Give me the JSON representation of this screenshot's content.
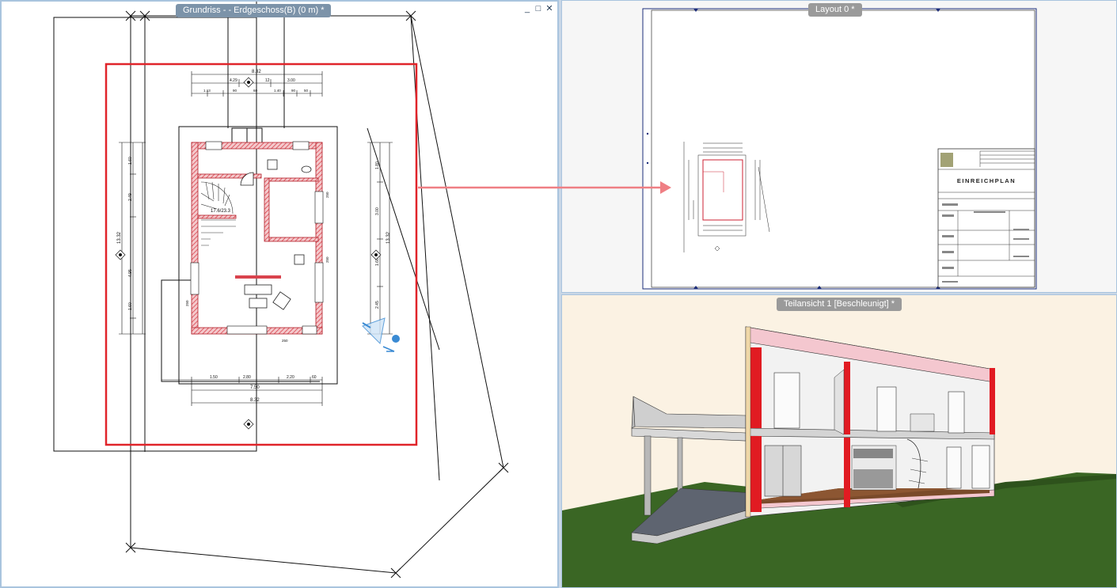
{
  "panes": {
    "plan": {
      "tab_label": "Grundriss -  - Erdgeschoss(B) (0 m) *",
      "controls": {
        "minimize": "_",
        "maximize": "□",
        "close": "✕"
      },
      "room_label": "17.6/23.3",
      "dimensions": {
        "top_total": "8.32",
        "top_row1": [
          "4.29",
          "12",
          "3.00"
        ],
        "top_row2": [
          "1.13",
          "90",
          "60",
          "1.40",
          "90",
          "50"
        ],
        "bottom_row1": [
          "1.50",
          "2.80",
          "2.20",
          "60"
        ],
        "bottom_total": "7.50",
        "bottom_overall": "8.32",
        "left_total": "13.32",
        "right_total": "13.32",
        "left_segments": [
          "1.60",
          "2.49",
          "4.95",
          "1.60"
        ],
        "right_segments": [
          "1.80",
          "3.00",
          "1.60",
          "2.45"
        ],
        "room_marks": [
          "250",
          "250",
          "250",
          "250"
        ]
      }
    },
    "layout": {
      "tab_label": "Layout 0 *",
      "title_block_heading": "EINREICHPLAN"
    },
    "view3d": {
      "tab_label": "Teilansicht 1 [Beschleunigt] *"
    }
  },
  "colors": {
    "accent_frame": "#e0242a",
    "arrow": "#ef7f84",
    "wall_hatch": "#d9434d",
    "tab_bg": "#7c93a9",
    "grass": "#3a6624",
    "section_cut": "#e11b22"
  }
}
